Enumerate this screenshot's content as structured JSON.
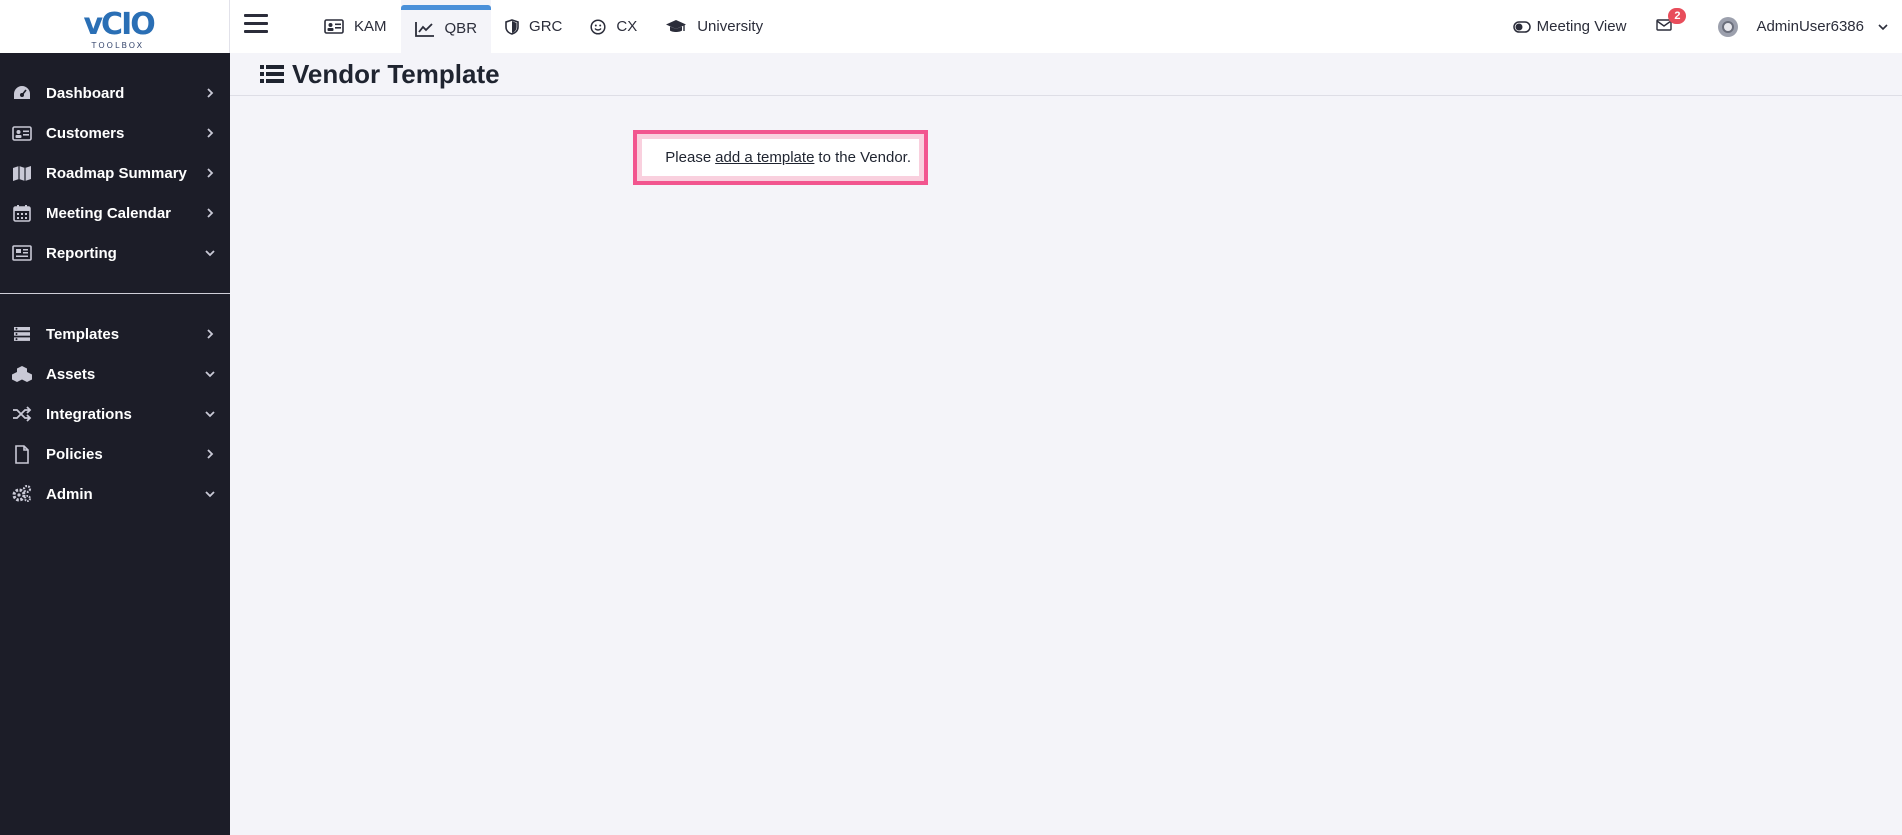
{
  "logo": {
    "main_text": "vCIO",
    "sub_text": "TOOLBOX"
  },
  "sidebar": {
    "items": [
      {
        "label": "Dashboard",
        "icon": "dashboard-icon",
        "chevron": "right"
      },
      {
        "label": "Customers",
        "icon": "address-card-icon",
        "chevron": "right"
      },
      {
        "label": "Roadmap Summary",
        "icon": "map-icon",
        "chevron": "right"
      },
      {
        "label": "Meeting Calendar",
        "icon": "calendar-icon",
        "chevron": "right"
      },
      {
        "label": "Reporting",
        "icon": "report-icon",
        "chevron": "down"
      }
    ],
    "items2": [
      {
        "label": "Templates",
        "icon": "templates-icon",
        "chevron": "right"
      },
      {
        "label": "Assets",
        "icon": "assets-icon",
        "chevron": "down"
      },
      {
        "label": "Integrations",
        "icon": "shuffle-icon",
        "chevron": "down"
      },
      {
        "label": "Policies",
        "icon": "file-icon",
        "chevron": "right"
      },
      {
        "label": "Admin",
        "icon": "gears-icon",
        "chevron": "down"
      }
    ]
  },
  "topbar": {
    "tabs": [
      {
        "label": "KAM",
        "icon": "id-card-icon"
      },
      {
        "label": "QBR",
        "icon": "line-chart-icon",
        "active": true
      },
      {
        "label": "GRC",
        "icon": "shield-icon"
      },
      {
        "label": "CX",
        "icon": "smile-icon"
      },
      {
        "label": "University",
        "icon": "graduation-cap-icon"
      }
    ],
    "meeting_view_label": "Meeting View",
    "mail_badge": "2",
    "username": "AdminUser6386"
  },
  "page": {
    "title": "Vendor Template",
    "notice_prefix": "Please",
    "notice_link": "add a template",
    "notice_suffix": "to the Vendor."
  },
  "colors": {
    "sidebar_bg": "#1c1d28",
    "accent": "#4a90d9",
    "highlight_border": "#f2558f",
    "badge": "#e84d5b"
  }
}
